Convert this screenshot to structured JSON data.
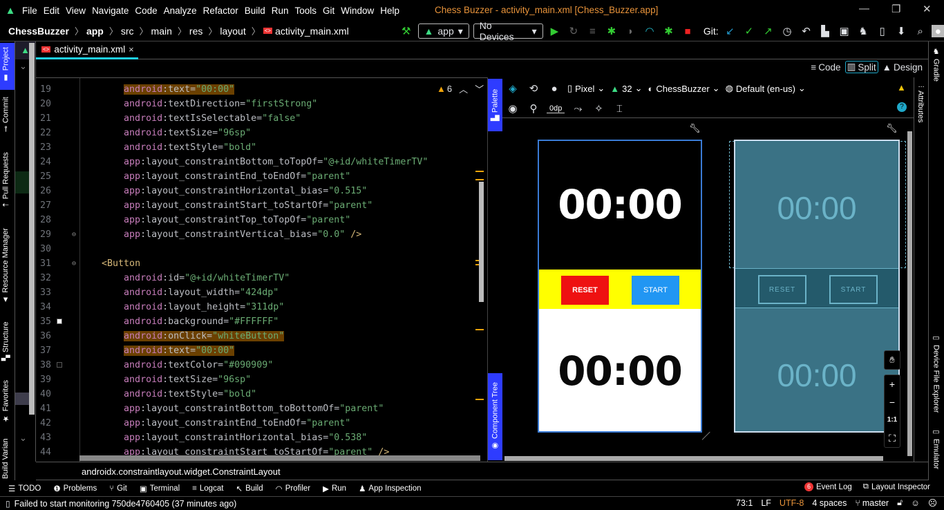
{
  "menu": {
    "items": [
      "File",
      "Edit",
      "View",
      "Navigate",
      "Code",
      "Analyze",
      "Refactor",
      "Build",
      "Run",
      "Tools",
      "Git",
      "Window",
      "Help"
    ],
    "title": "Chess Buzzer - activity_main.xml [Chess_Buzzer.app]"
  },
  "breadcrumb": [
    "ChessBuzzer",
    "app",
    "src",
    "main",
    "res",
    "layout",
    "activity_main.xml"
  ],
  "toolbar": {
    "run_config": "app",
    "device": "No Devices",
    "git_label": "Git:"
  },
  "left_tools": [
    "Project",
    "Commit",
    "Pull Requests",
    "Resource Manager",
    "Structure",
    "Favorites",
    "Build Variants"
  ],
  "right_tools": [
    "Gradle",
    "Device File Explorer",
    "Emulator"
  ],
  "tab": {
    "label": "activity_main.xml",
    "close": "×"
  },
  "modes": {
    "code": "Code",
    "split": "Split",
    "design": "Design",
    "active": "Split"
  },
  "editor": {
    "warnings": "6",
    "lines": [
      {
        "num": "19",
        "indent": "        ",
        "ns": "android",
        "attr": ":text=",
        "val": "\"00:00\"",
        "hl": true
      },
      {
        "num": "20",
        "indent": "        ",
        "ns": "android",
        "attr": ":textDirection=",
        "val": "\"firstStrong\""
      },
      {
        "num": "21",
        "indent": "        ",
        "ns": "android",
        "attr": ":textIsSelectable=",
        "val": "\"false\""
      },
      {
        "num": "22",
        "indent": "        ",
        "ns": "android",
        "attr": ":textSize=",
        "val": "\"96sp\""
      },
      {
        "num": "23",
        "indent": "        ",
        "ns": "android",
        "attr": ":textStyle=",
        "val": "\"bold\""
      },
      {
        "num": "24",
        "indent": "        ",
        "ns": "app",
        "attr": ":layout_constraintBottom_toTopOf=",
        "val": "\"@+id/whiteTimerTV\""
      },
      {
        "num": "25",
        "indent": "        ",
        "ns": "app",
        "attr": ":layout_constraintEnd_toEndOf=",
        "val": "\"parent\""
      },
      {
        "num": "26",
        "indent": "        ",
        "ns": "app",
        "attr": ":layout_constraintHorizontal_bias=",
        "val": "\"0.515\""
      },
      {
        "num": "27",
        "indent": "        ",
        "ns": "app",
        "attr": ":layout_constraintStart_toStartOf=",
        "val": "\"parent\""
      },
      {
        "num": "28",
        "indent": "        ",
        "ns": "app",
        "attr": ":layout_constraintTop_toTopOf=",
        "val": "\"parent\""
      },
      {
        "num": "29",
        "indent": "        ",
        "ns": "app",
        "attr": ":layout_constraintVertical_bias=",
        "val": "\"0.0\"",
        "tail": " />"
      },
      {
        "num": "30",
        "indent": ""
      },
      {
        "num": "31",
        "indent": "    ",
        "tag": "<Button"
      },
      {
        "num": "32",
        "indent": "        ",
        "ns": "android",
        "attr": ":id=",
        "val": "\"@+id/whiteTimerTV\""
      },
      {
        "num": "33",
        "indent": "        ",
        "ns": "android",
        "attr": ":layout_width=",
        "val": "\"424dp\""
      },
      {
        "num": "34",
        "indent": "        ",
        "ns": "android",
        "attr": ":layout_height=",
        "val": "\"311dp\""
      },
      {
        "num": "35",
        "indent": "        ",
        "ns": "android",
        "attr": ":background=",
        "val": "\"#FFFFFF\"",
        "swatch": "#FFFFFF"
      },
      {
        "num": "36",
        "indent": "        ",
        "ns": "android",
        "attr": ":onClick=",
        "val": "\"whiteButton\"",
        "hl": true
      },
      {
        "num": "37",
        "indent": "        ",
        "ns": "android",
        "attr": ":text=",
        "val": "\"00:00\"",
        "hl": true
      },
      {
        "num": "38",
        "indent": "        ",
        "ns": "android",
        "attr": ":textColor=",
        "val": "\"#090909\"",
        "swatch": "#090909"
      },
      {
        "num": "39",
        "indent": "        ",
        "ns": "android",
        "attr": ":textSize=",
        "val": "\"96sp\""
      },
      {
        "num": "40",
        "indent": "        ",
        "ns": "android",
        "attr": ":textStyle=",
        "val": "\"bold\""
      },
      {
        "num": "41",
        "indent": "        ",
        "ns": "app",
        "attr": ":layout_constraintBottom_toBottomOf=",
        "val": "\"parent\""
      },
      {
        "num": "42",
        "indent": "        ",
        "ns": "app",
        "attr": ":layout_constraintEnd_toEndOf=",
        "val": "\"parent\""
      },
      {
        "num": "43",
        "indent": "        ",
        "ns": "app",
        "attr": ":layout_constraintHorizontal_bias=",
        "val": "\"0.538\""
      },
      {
        "num": "44",
        "indent": "        ",
        "ns": "app",
        "attr": ":layout_constraintStart_toStartOf=",
        "val": "\"parent\"",
        "tail": " />"
      }
    ]
  },
  "side_tabs": {
    "palette": "Palette",
    "component_tree": "Component Tree",
    "attributes": "Attributes"
  },
  "design_toolbar": {
    "device": "Pixel",
    "api": "32",
    "theme": "ChessBuzzer",
    "locale": "Default (en-us)",
    "margin": "0dp"
  },
  "preview": {
    "top_timer": "00:00",
    "bottom_timer": "00:00",
    "reset": "RESET",
    "start": "START",
    "top_bg": "#000000",
    "mid_bg": "#FFFF00",
    "bottom_bg": "#FFFFFF",
    "reset_bg": "#EE1111",
    "start_bg": "#2196F3"
  },
  "blueprint": {
    "top_timer": "00:00",
    "bottom_timer": "00:00",
    "reset": "RESET",
    "start": "START"
  },
  "zoom_controls": {
    "plus": "+",
    "minus": "−",
    "one_to_one": "1:1"
  },
  "component_path": "androidx.constraintlayout.widget.ConstraintLayout",
  "tool_windows": [
    "TODO",
    "Problems",
    "Git",
    "Terminal",
    "Logcat",
    "Build",
    "Profiler",
    "Run",
    "App Inspection"
  ],
  "tool_windows_right": {
    "event_log": "Event Log",
    "event_count": "6",
    "layout_inspector": "Layout Inspector"
  },
  "status": {
    "message": "Failed to start monitoring 750de4760405 (37 minutes ago)",
    "position": "73:1",
    "line_sep": "LF",
    "encoding": "UTF-8",
    "indent": "4 spaces",
    "branch": "master"
  }
}
